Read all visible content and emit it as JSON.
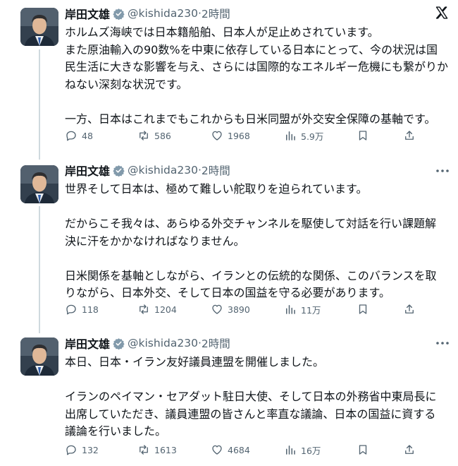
{
  "tweets": [
    {
      "author_name": "岸田文雄",
      "handle": "@kishida230",
      "separator": "·",
      "time": "2時間",
      "lines": [
        "ホルムズ海峡では日本籍船舶、日本人が足止めされています。",
        "また原油輸入の90数%を中東に依存している日本にとって、今の状況は国",
        "民生活に大きな影響を与え、さらには国際的なエネルギー危機にも繋がりか",
        "ねない深刻な状況です。",
        "一方、日本はこれまでもこれからも日米同盟が外交安全保障の基軸です。"
      ],
      "replies": "48",
      "reposts": "586",
      "likes": "1968",
      "views": "5.9万"
    },
    {
      "author_name": "岸田文雄",
      "handle": "@kishida230",
      "separator": "·",
      "time": "2時間",
      "lines": [
        "世界そして日本は、極めて難しい舵取りを迫られています。",
        "だからこそ我々は、あらゆる外交チャンネルを駆使して対話を行い課題解",
        "決に汗をかかなければなりません。",
        "日米関係を基軸としながら、イランとの伝統的な関係、このバランスを取",
        "りながら、日本外交、そして日本の国益を守る必要があります。"
      ],
      "replies": "118",
      "reposts": "1204",
      "likes": "3890",
      "views": "11万"
    },
    {
      "author_name": "岸田文雄",
      "handle": "@kishida230",
      "separator": "·",
      "time": "2時間",
      "lines": [
        "本日、日本・イラン友好議員連盟を開催しました。",
        "イランのペイマン・セアダット駐日大使、そして日本の外務省中東局長に",
        "出席していただき、議員連盟の皆さんと率直な議論、日本の国益に資する",
        "議論を行いました。"
      ],
      "replies": "132",
      "reposts": "1613",
      "likes": "4684",
      "views": "16万"
    }
  ]
}
